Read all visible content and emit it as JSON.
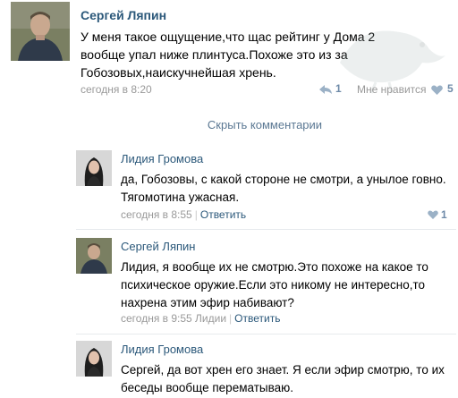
{
  "post": {
    "author": "Сергей Ляпин",
    "text": "У меня такое ощущение,что щас рейтинг у Дома 2 вообще упал ниже плинтуса.Похоже это из за Гобозовых,наискучнейшая хрень.",
    "time": "сегодня в 8:20",
    "reply_count": "1",
    "like_label": "Мне нравится",
    "like_count": "5"
  },
  "hide_comments": "Скрыть комментарии",
  "comments": [
    {
      "author": "Лидия Громова",
      "text": "да, Гобозовы, с какой стороне не смотри, а унылое говно. Тягомотина ужасная.",
      "time": "сегодня в 8:55",
      "reply": "Ответить",
      "likes": "1"
    },
    {
      "author": "Сергей Ляпин",
      "text": "Лидия, я вообще их не смотрю.Это похоже на какое то психическое оружие.Если это никому не интересно,то нахрена этим эфир набивают?",
      "time": "сегодня в 9:55 Лидии",
      "reply": "Ответить"
    },
    {
      "author": "Лидия Громова",
      "text": "Сергей, да вот хрен его знает. Я если эфир смотрю, то их беседы вообще перематываю."
    }
  ],
  "colors": {
    "link": "#2b587a",
    "muted": "#999999",
    "count": "#6e8aa8"
  }
}
